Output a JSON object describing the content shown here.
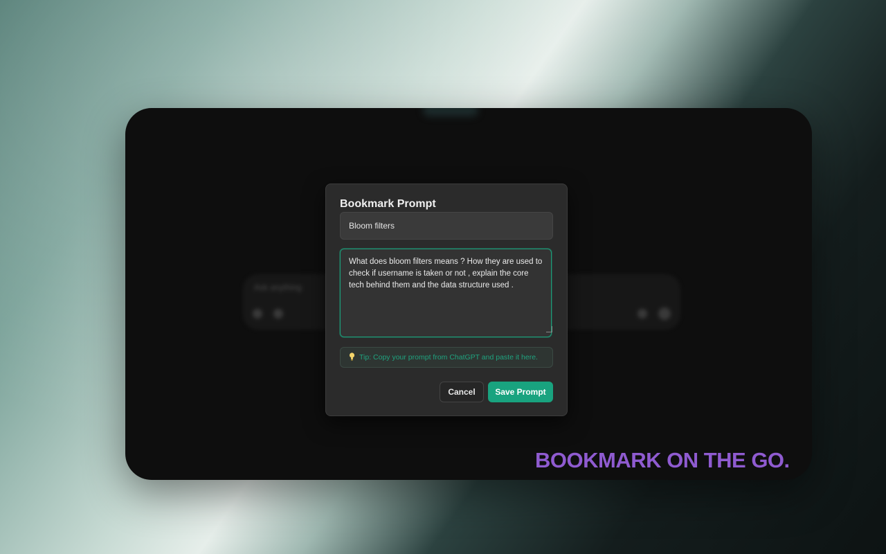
{
  "dialog": {
    "title": "Bookmark Prompt",
    "title_value": "Bloom filters",
    "prompt_value": "What does bloom filters means ? How they are used to check if username is taken or not , explain the core tech behind them and the data structure used .",
    "tip_icon": "lightbulb-icon",
    "tip_text": "Tip: Copy your prompt from ChatGPT and paste it here.",
    "cancel_label": "Cancel",
    "save_label": "Save Prompt"
  },
  "background_app": {
    "placeholder": "Ask anything"
  },
  "tagline": "BOOKMARK ON THE GO.",
  "colors": {
    "accent": "#19a37f",
    "tagline": "#8f5bd0",
    "dialog_bg": "#2b2b2b"
  }
}
